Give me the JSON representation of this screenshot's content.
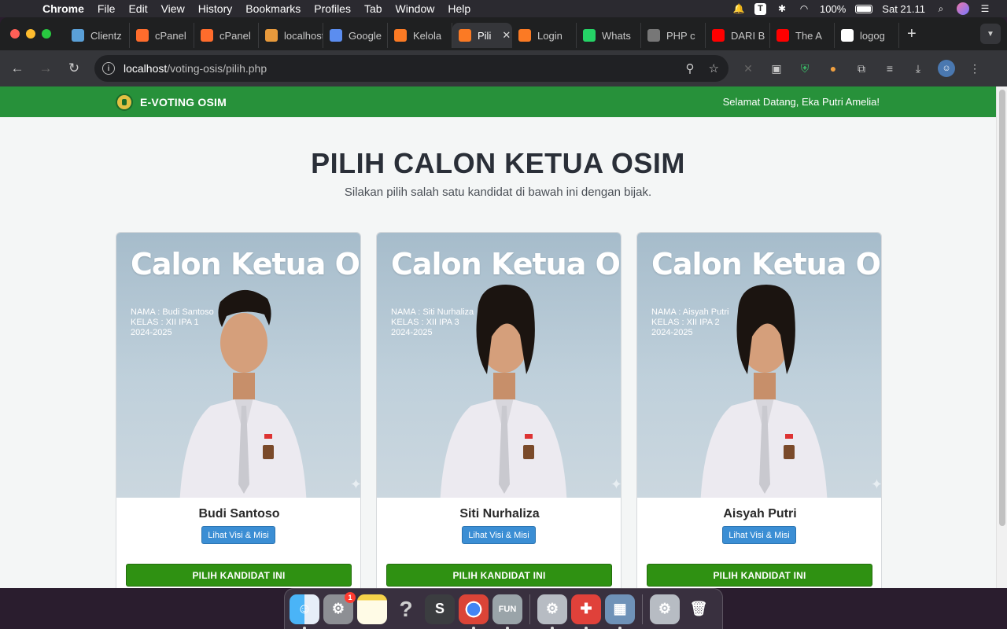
{
  "menubar": {
    "app_name": "Chrome",
    "items": [
      "File",
      "Edit",
      "View",
      "History",
      "Bookmarks",
      "Profiles",
      "Tab",
      "Window",
      "Help"
    ],
    "battery": "100%",
    "clock": "Sat 21.11"
  },
  "browser": {
    "tabs": [
      {
        "label": "Clientz",
        "icon": "clientzone-icon",
        "color": "#5aa0d8"
      },
      {
        "label": "cPanel",
        "icon": "cpanel-icon",
        "color": "#ff6c2c"
      },
      {
        "label": "cPanel",
        "icon": "cpanel-icon",
        "color": "#ff6c2c"
      },
      {
        "label": "localhost",
        "icon": "localhost-icon",
        "color": "#e89a3c"
      },
      {
        "label": "Google",
        "icon": "gemini-icon",
        "color": "#5b8def"
      },
      {
        "label": "Kelola",
        "icon": "xampp-icon",
        "color": "#fb7a24"
      },
      {
        "label": "Pili",
        "icon": "xampp-icon",
        "color": "#fb7a24",
        "active": true
      },
      {
        "label": "Login",
        "icon": "xampp-icon",
        "color": "#fb7a24"
      },
      {
        "label": "Whats",
        "icon": "whatsapp-icon",
        "color": "#25d366"
      },
      {
        "label": "PHP c",
        "icon": "openai-icon",
        "color": "#777777"
      },
      {
        "label": "DARI B",
        "icon": "youtube-icon",
        "color": "#ff0000"
      },
      {
        "label": "The A",
        "icon": "youtube-icon",
        "color": "#ff0000"
      },
      {
        "label": "logog",
        "icon": "google-icon",
        "color": "#ffffff"
      }
    ],
    "url_host": "localhost",
    "url_path": "/voting-osis/pilih.php"
  },
  "app": {
    "brand": "E-VOTING OSIM",
    "welcome": "Selamat Datang, Eka Putri Amelia!",
    "title": "PILIH CALON KETUA OSIM",
    "subtitle": "Silakan pilih salah satu kandidat di bawah ini dengan bijak.",
    "visi_label": "Lihat Visi & Misi",
    "vote_label": "PILIH KANDIDAT INI",
    "poster_title": "Calon Ketua OSIS",
    "candidates": [
      {
        "name": "Budi Santoso",
        "poster_name": "NAMA : Budi Santoso",
        "poster_class": "KELAS : XII IPA 1",
        "poster_year": "2024-2025",
        "gender": "male"
      },
      {
        "name": "Siti Nurhaliza",
        "poster_name": "NAMA : Siti Nurhaliza",
        "poster_class": "KELAS : XII IPA 3",
        "poster_year": "2024-2025",
        "gender": "female"
      },
      {
        "name": "Aisyah Putri",
        "poster_name": "NAMA : Aisyah Putri",
        "poster_class": "KELAS : XII IPA 2",
        "poster_year": "2024-2025",
        "gender": "female"
      }
    ]
  },
  "colors": {
    "header_green": "#27913a",
    "vote_green": "#2f9112",
    "visi_blue": "#3b8ed4"
  },
  "dock": {
    "apps": [
      "finder-icon",
      "system-preferences-icon",
      "notes-icon",
      "help-icon",
      "sublime-text-icon",
      "chrome-icon",
      "fun-app-icon",
      "system-settings-icon",
      "xmind-icon",
      "preview-icon",
      "system-settings-icon",
      "trash-icon"
    ],
    "badge": "1"
  }
}
